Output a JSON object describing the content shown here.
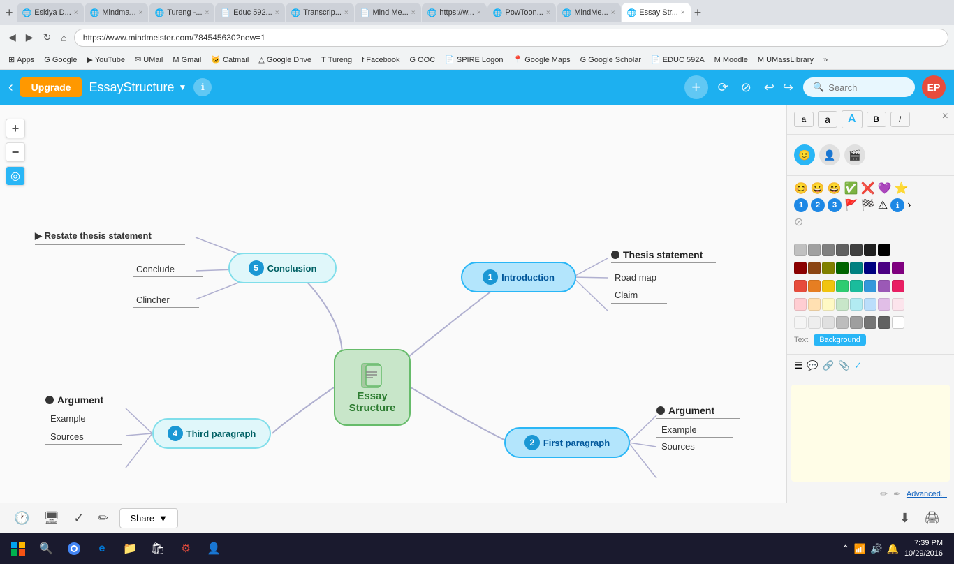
{
  "browser": {
    "tabs": [
      {
        "label": "Eskiya D...",
        "active": false,
        "icon": "🌐"
      },
      {
        "label": "Mindma...",
        "active": false,
        "icon": "🌐"
      },
      {
        "label": "Tureng -...",
        "active": false,
        "icon": "🌐"
      },
      {
        "label": "Educ 592...",
        "active": false,
        "icon": "📄"
      },
      {
        "label": "Transcrip...",
        "active": false,
        "icon": "🌐"
      },
      {
        "label": "Mind Me...",
        "active": false,
        "icon": "📄"
      },
      {
        "label": "https://w...",
        "active": false,
        "icon": "🌐"
      },
      {
        "label": "PowToon...",
        "active": false,
        "icon": "🌐"
      },
      {
        "label": "MindMe...",
        "active": false,
        "icon": "🌐"
      },
      {
        "label": "Essay Str...",
        "active": true,
        "icon": "🌐"
      }
    ],
    "address": "https://www.mindmeister.com/784545630?new=1",
    "bookmarks": [
      {
        "label": "Apps",
        "icon": "⊞"
      },
      {
        "label": "Google",
        "icon": "G"
      },
      {
        "label": "YouTube",
        "icon": "▶"
      },
      {
        "label": "UMail",
        "icon": "✉"
      },
      {
        "label": "Gmail",
        "icon": "M"
      },
      {
        "label": "Catmail",
        "icon": "🐱"
      },
      {
        "label": "Google Drive",
        "icon": "△"
      },
      {
        "label": "Tureng",
        "icon": "T"
      },
      {
        "label": "Facebook",
        "icon": "f"
      },
      {
        "label": "OOC",
        "icon": "G"
      },
      {
        "label": "SPIRE Logon",
        "icon": "📄"
      },
      {
        "label": "Google Maps",
        "icon": "📍"
      },
      {
        "label": "Google Scholar",
        "icon": "G"
      },
      {
        "label": "EDUC 592A",
        "icon": "📄"
      },
      {
        "label": "Moodle",
        "icon": "M"
      },
      {
        "label": "UMassLibrary",
        "icon": "M"
      },
      {
        "label": "»",
        "icon": ""
      }
    ]
  },
  "toolbar": {
    "upgrade_label": "Upgrade",
    "app_title": "EssayStructure",
    "search_placeholder": "Search",
    "avatar_initials": "EP"
  },
  "mindmap": {
    "center_node": {
      "label1": "Essay",
      "label2": "Structure"
    },
    "nodes": {
      "introduction": {
        "number": "1",
        "label": "Introduction"
      },
      "first_paragraph": {
        "number": "2",
        "label": "First paragraph"
      },
      "third_paragraph": {
        "number": "4",
        "label": "Third paragraph"
      },
      "conclusion": {
        "number": "5",
        "label": "Conclusion"
      }
    },
    "branches": {
      "introduction_children": [
        "Thesis statement",
        "Road map",
        "Claim"
      ],
      "first_paragraph_children": [
        "Argument",
        "Example",
        "Sources"
      ],
      "third_paragraph_children": [
        "Argument",
        "Example",
        "Sources"
      ],
      "conclusion_children": [
        "Restate thesis statement",
        "Conclude",
        "Clincher"
      ]
    }
  },
  "right_panel": {
    "text_styles": {
      "small_a": "a",
      "large_a": "a",
      "bold_a": "A",
      "bold": "B",
      "italic": "I"
    },
    "toggle": {
      "text_label": "Text",
      "background_label": "Background"
    },
    "note_placeholder": "",
    "advanced_label": "Advanced..."
  },
  "bottom_bar": {
    "share_label": "Share"
  },
  "taskbar": {
    "time": "7:39 PM",
    "date": "10/29/2016"
  },
  "colors": {
    "row1": [
      "#c0c0c0",
      "#a0a0a0",
      "#808080",
      "#606060",
      "#404040",
      "#202020",
      "#000000"
    ],
    "row2": [
      "#8b0000",
      "#8b4513",
      "#808000",
      "#006400",
      "#008080",
      "#000080",
      "#4b0082",
      "#800080"
    ],
    "row3": [
      "#e74c3c",
      "#e67e22",
      "#f1c40f",
      "#2ecc71",
      "#1abc9c",
      "#3498db",
      "#9b59b6",
      "#e91e63"
    ],
    "row4": [
      "#ffcdd2",
      "#ffe0b2",
      "#fff9c4",
      "#c8e6c9",
      "#b2ebf2",
      "#bbdefb",
      "#e1bee7",
      "#fce4ec"
    ],
    "row5": [
      "#f5f5f5",
      "#eeeeee",
      "#e0e0e0",
      "#bdbdbd",
      "#9e9e9e",
      "#757575",
      "#616161",
      "#ffffff"
    ]
  }
}
